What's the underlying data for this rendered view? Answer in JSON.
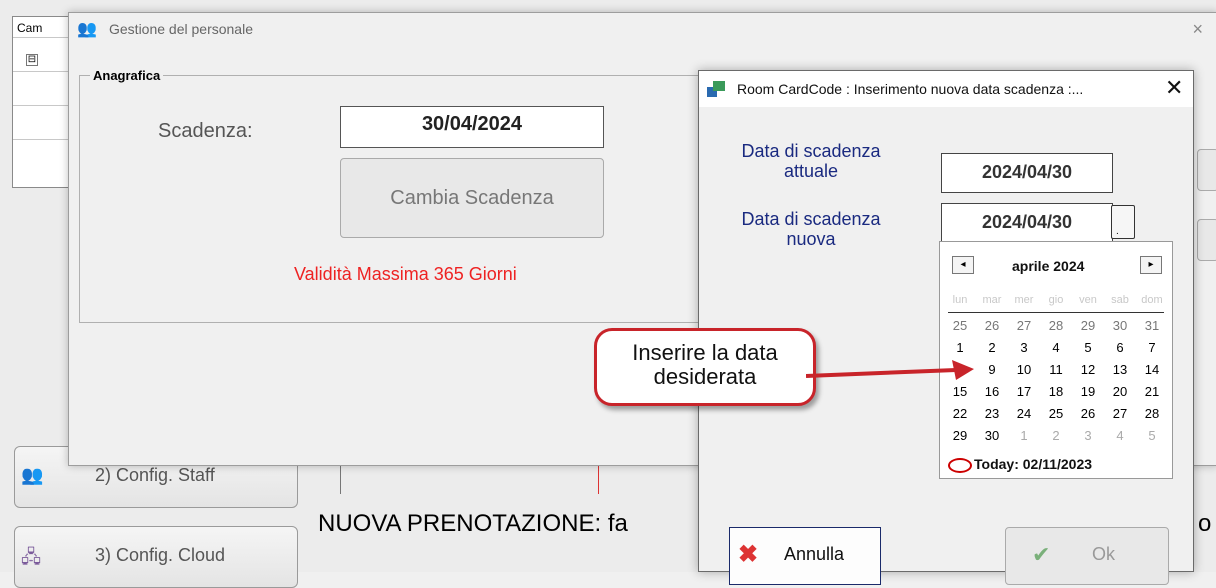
{
  "background": {
    "col_header": "Cam",
    "tree_toggle": "⊟",
    "side_buttons": [
      {
        "label": "2) Config. Staff",
        "icon": "staff-icon"
      },
      {
        "label": "3) Config. Cloud",
        "icon": "cloud-icon"
      }
    ],
    "nuova_text": "NUOVA PRENOTAZIONE: fa",
    "trailing_letter": "o"
  },
  "main_window": {
    "title": "Gestione del personale",
    "close": "×",
    "group_label": "Anagrafica",
    "scadenza_label": "Scadenza:",
    "scadenza_value": "30/04/2024",
    "cambia_button": "Cambia Scadenza",
    "validita_text": "Validità Massima 365 Giorni",
    "validita_color": "#e22222"
  },
  "dialog": {
    "title": "Room CardCode : Inserimento nuova data scadenza :...",
    "close": "✕",
    "current_label_1": "Data di scadenza",
    "current_label_2": "attuale",
    "current_value": "2024/04/30",
    "new_label_1": "Data di scadenza",
    "new_label_2": "nuova",
    "new_value": "2024/04/30",
    "annulla_label": "Annulla",
    "ok_label": "Ok"
  },
  "calendar": {
    "prev": "◂",
    "next": "▸",
    "month": "aprile 2024",
    "weekdays": [
      "lun",
      "mar",
      "mer",
      "gio",
      "ven",
      "sab",
      "dom"
    ],
    "weeks": [
      [
        "25",
        "26",
        "27",
        "28",
        "29",
        "30",
        "31"
      ],
      [
        "1",
        "2",
        "3",
        "4",
        "5",
        "6",
        "7"
      ],
      [
        "8",
        "9",
        "10",
        "11",
        "12",
        "13",
        "14"
      ],
      [
        "15",
        "16",
        "17",
        "18",
        "19",
        "20",
        "21"
      ],
      [
        "22",
        "23",
        "24",
        "25",
        "26",
        "27",
        "28"
      ],
      [
        "29",
        "30",
        "1",
        "2",
        "3",
        "4",
        "5"
      ]
    ],
    "today_label": "Today: 02/11/2023"
  },
  "callout": {
    "line1": "Inserire la data",
    "line2": "desiderata",
    "border_color": "#c8242a"
  }
}
